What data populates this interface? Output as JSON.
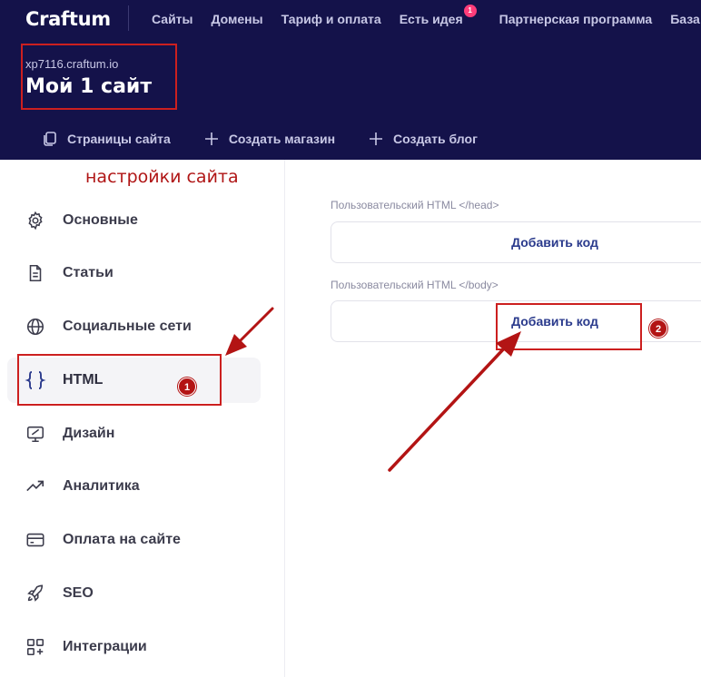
{
  "header": {
    "logo": "Craftum",
    "nav": [
      {
        "label": "Сайты"
      },
      {
        "label": "Домены"
      },
      {
        "label": "Тариф и оплата"
      },
      {
        "label": "Есть идея",
        "badge": "1"
      },
      {
        "label": "Партнерская программа"
      },
      {
        "label": "База"
      }
    ],
    "site_domain": "xp7116.craftum.io",
    "site_title": "Мой 1 сайт",
    "subnav": [
      {
        "label": "Страницы сайта",
        "icon": "pages-icon"
      },
      {
        "label": "Создать магазин",
        "icon": "plus-icon"
      },
      {
        "label": "Создать блог",
        "icon": "plus-icon"
      }
    ]
  },
  "sidebar": {
    "annotation": "настройки сайта",
    "items": [
      {
        "label": "Основные",
        "icon": "gear-icon"
      },
      {
        "label": "Статьи",
        "icon": "document-icon"
      },
      {
        "label": "Социальные сети",
        "icon": "globe-icon"
      },
      {
        "label": "HTML",
        "icon": "braces-icon",
        "active": true
      },
      {
        "label": "Дизайн",
        "icon": "design-icon"
      },
      {
        "label": "Аналитика",
        "icon": "trend-icon"
      },
      {
        "label": "Оплата на сайте",
        "icon": "card-icon"
      },
      {
        "label": "SEO",
        "icon": "rocket-icon"
      },
      {
        "label": "Интеграции",
        "icon": "grid-plus-icon"
      }
    ]
  },
  "main": {
    "head_label": "Пользовательский HTML </head>",
    "head_button": "Добавить код",
    "body_label": "Пользовательский HTML </body>",
    "body_button": "Добавить код"
  },
  "annotations": {
    "step1": "1",
    "step2": "2",
    "color": "#cc1f1f"
  },
  "colors": {
    "header_bg": "#14124a",
    "accent_link": "#2a3a8c",
    "badge": "#ff3d7a"
  }
}
